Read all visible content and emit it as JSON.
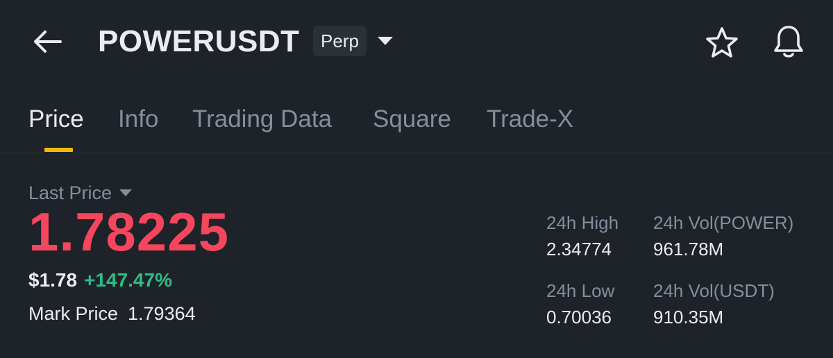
{
  "header": {
    "back_icon": "arrow-left-icon",
    "symbol": "POWERUSDT",
    "contract_type": "Perp",
    "dropdown_icon": "caret-down-icon",
    "favorite_icon": "star-icon",
    "alert_icon": "bell-icon"
  },
  "tabs": [
    {
      "label": "Price",
      "active": true
    },
    {
      "label": "Info",
      "active": false
    },
    {
      "label": "Trading Data",
      "active": false
    },
    {
      "label": "Square",
      "active": false
    },
    {
      "label": "Trade-X",
      "active": false
    }
  ],
  "price": {
    "label": "Last Price",
    "label_icon": "caret-down-icon",
    "last_price": "1.78225",
    "usd_price": "$1.78",
    "change_percent": "+147.47%",
    "mark_price_label": "Mark Price",
    "mark_price": "1.79364"
  },
  "stats": {
    "high_label": "24h High",
    "high_value": "2.34774",
    "low_label": "24h Low",
    "low_value": "0.70036",
    "vol_base_label": "24h Vol(POWER)",
    "vol_base_value": "961.78M",
    "vol_quote_label": "24h Vol(USDT)",
    "vol_quote_value": "910.35M"
  },
  "colors": {
    "background": "#1e2329",
    "accent": "#f0b90b",
    "price_down": "#f6465d",
    "change_up": "#2ebd85",
    "muted_text": "#848e9c",
    "primary_text": "#eaecef"
  }
}
